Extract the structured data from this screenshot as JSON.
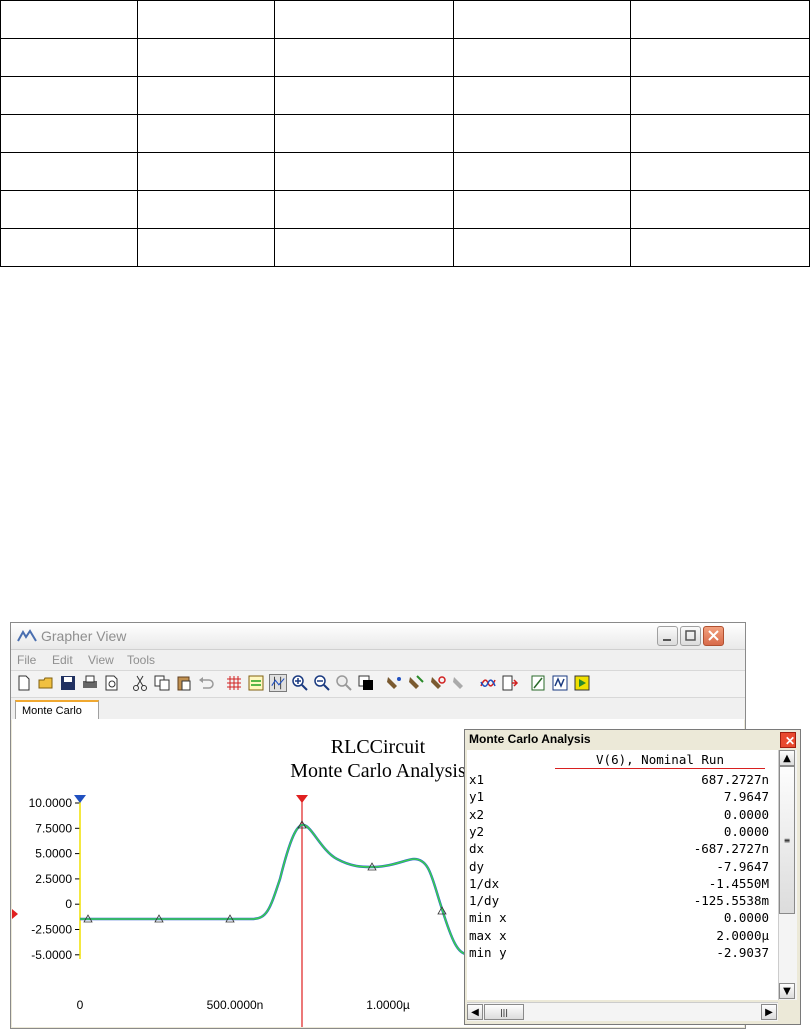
{
  "window": {
    "title": "Grapher View",
    "menu": [
      "File",
      "Edit",
      "View",
      "Tools"
    ],
    "tab": "Monte Carlo"
  },
  "graph": {
    "title_line1": "RLCCircuit",
    "title_line2": "Monte Carlo Analysis",
    "x_ticks": [
      "0",
      "500.0000n",
      "1.0000µ"
    ],
    "y_ticks": [
      "10.0000",
      "7.5000",
      "5.0000",
      "2.5000",
      "0",
      "-2.5000",
      "-5.0000"
    ]
  },
  "dialog": {
    "title": "Monte Carlo Analysis",
    "column_header": "V(6), Nominal Run",
    "rows": [
      {
        "label": "x1",
        "value": "687.2727n"
      },
      {
        "label": "y1",
        "value": "7.9647"
      },
      {
        "label": "x2",
        "value": "0.0000"
      },
      {
        "label": "y2",
        "value": "0.0000"
      },
      {
        "label": "dx",
        "value": "-687.2727n"
      },
      {
        "label": "dy",
        "value": "-7.9647"
      },
      {
        "label": "1/dx",
        "value": "-1.4550M"
      },
      {
        "label": "1/dy",
        "value": "-125.5538m"
      },
      {
        "label": "min x",
        "value": "0.0000"
      },
      {
        "label": "max x",
        "value": "2.0000µ"
      },
      {
        "label": "min y",
        "value": "-2.9037"
      }
    ]
  },
  "colors": {
    "cursor1": "#f0e000",
    "cursor2": "#e02020",
    "trace_a": "#39d24a",
    "trace_b": "#2a5fd0",
    "accent_tab": "#f0a830"
  }
}
